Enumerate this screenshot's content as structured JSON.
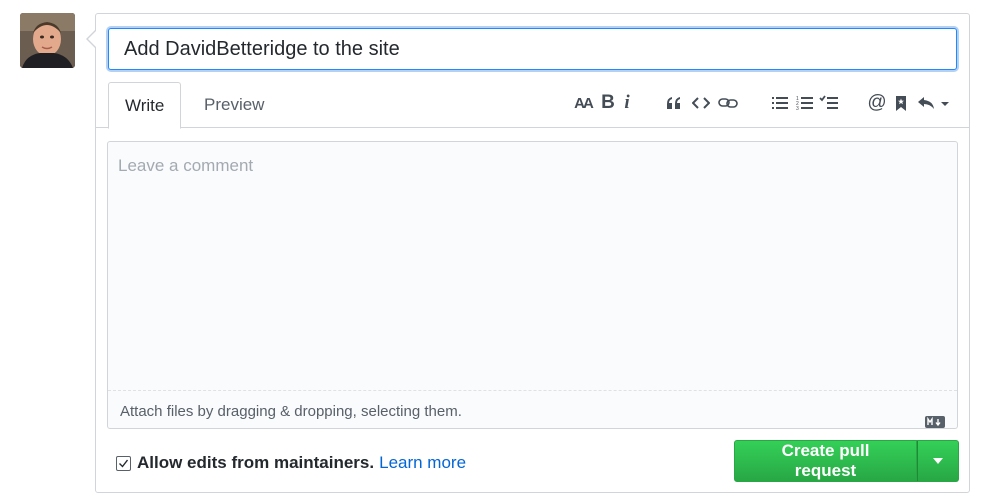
{
  "pull_request": {
    "title_value": "Add DavidBetteridge to the site",
    "tabs": {
      "write": "Write",
      "preview": "Preview"
    },
    "toolbar": {
      "header_label": "AA",
      "bold_label": "B",
      "italic_label": "i",
      "icons": [
        "header-icon",
        "bold-icon",
        "italic-icon",
        "quote-icon",
        "code-icon",
        "link-icon",
        "unordered-list-icon",
        "ordered-list-icon",
        "task-list-icon",
        "mention-icon",
        "reference-icon",
        "reply-icon"
      ]
    },
    "comment": {
      "placeholder": "Leave a comment",
      "attach_text": "Attach files by dragging & dropping, selecting them."
    },
    "allow_edits": {
      "checked": true,
      "label": "Allow edits from maintainers.",
      "link": "Learn more"
    },
    "submit": {
      "label": "Create pull request"
    }
  },
  "colors": {
    "accent_blue": "#0366d6",
    "button_green": "#28a745",
    "border": "#d1d5da"
  }
}
